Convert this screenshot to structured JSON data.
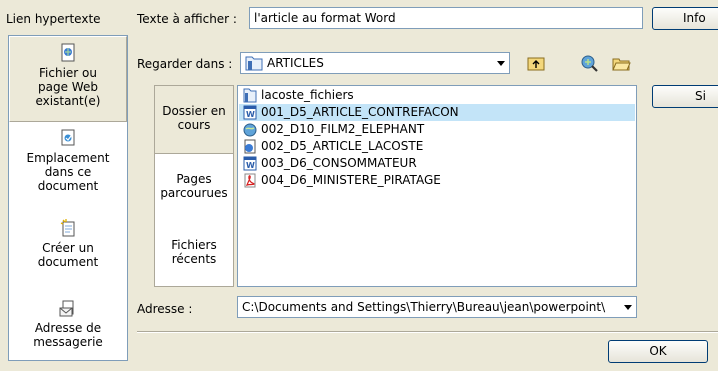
{
  "dialog": {
    "link_label": "Lien hypertexte",
    "link_options": [
      {
        "label": "Fichier ou page Web existant(e)",
        "icon": "web-page-icon"
      },
      {
        "label": "Emplacement dans ce document",
        "icon": "document-place-icon"
      },
      {
        "label": "Créer un document",
        "icon": "new-document-icon"
      },
      {
        "label": "Adresse de messagerie",
        "icon": "email-icon"
      }
    ],
    "texte_label": "Texte à afficher :",
    "texte_value": "l'article au format Word",
    "info_button": "Info",
    "regarder_label": "Regarder dans :",
    "regarder_value": "ARTICLES",
    "tabs": [
      {
        "label": "Dossier en cours"
      },
      {
        "label": "Pages parcourues"
      },
      {
        "label": "Fichiers récents"
      }
    ],
    "files": [
      {
        "name": "lacoste_fichiers",
        "icon": "folder-icon"
      },
      {
        "name": "001_D5_ARTICLE_CONTREFACON",
        "icon": "word-doc-icon"
      },
      {
        "name": "002_D10_FILM2_ELEPHANT",
        "icon": "web-file-icon"
      },
      {
        "name": "002_D5_ARTICLE_LACOSTE",
        "icon": "html-file-icon"
      },
      {
        "name": "003_D6_CONSOMMATEUR",
        "icon": "word-doc-icon"
      },
      {
        "name": "004_D6_MINISTERE_PIRATAGE",
        "icon": "pdf-icon"
      }
    ],
    "signet_button": "Si",
    "adresse_label": "Adresse :",
    "adresse_value": "C:\\Documents and Settings\\Thierry\\Bureau\\jean\\powerpoint\\",
    "ok_button": "OK"
  }
}
